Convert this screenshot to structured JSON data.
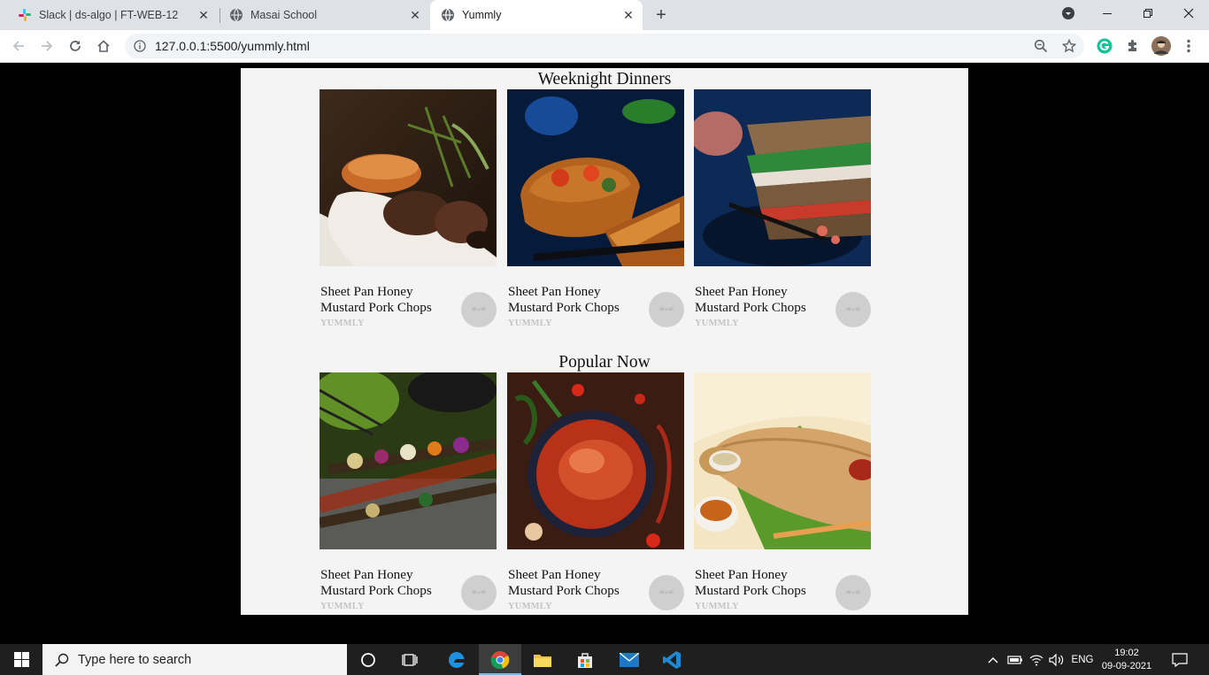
{
  "browser": {
    "tabs": [
      {
        "title": "Slack | ds-algo | FT-WEB-12",
        "icon": "slack-icon",
        "active": false
      },
      {
        "title": "Masai School",
        "icon": "globe-icon",
        "active": false
      },
      {
        "title": "Yummly",
        "icon": "globe-icon",
        "active": true
      }
    ],
    "url": "127.0.0.1:5500/yummly.html"
  },
  "page": {
    "sections": [
      {
        "title": "Weeknight Dinners",
        "cards": [
          {
            "caption": "Sheet Pan Honey Mustard Pork Chops",
            "source": "YUMMLY",
            "avatar_text": "60 x 60",
            "image": "lamb-salmon-plate"
          },
          {
            "caption": "Sheet Pan Honey Mustard Pork Chops",
            "source": "YUMMLY",
            "avatar_text": "60 x 60",
            "image": "vegetable-quiche"
          },
          {
            "caption": "Sheet Pan Honey Mustard Pork Chops",
            "source": "YUMMLY",
            "avatar_text": "60 x 60",
            "image": "club-sandwich"
          }
        ]
      },
      {
        "title": "Popular Now",
        "cards": [
          {
            "caption": "Sheet Pan Honey Mustard Pork Chops",
            "source": "YUMMLY",
            "avatar_text": "60 x 60",
            "image": "grill-skewers"
          },
          {
            "caption": "Sheet Pan Honey Mustard Pork Chops",
            "source": "YUMMLY",
            "avatar_text": "60 x 60",
            "image": "fish-curry"
          },
          {
            "caption": "Sheet Pan Honey Mustard Pork Chops",
            "source": "YUMMLY",
            "avatar_text": "60 x 60",
            "image": "dosa"
          }
        ]
      }
    ]
  },
  "taskbar": {
    "search_placeholder": "Type here to search",
    "language": "ENG",
    "time": "19:02",
    "date": "09-09-2021"
  },
  "colors": {
    "page_bg": "#f4f4f4",
    "outer_bg": "#000000",
    "source_text": "#c4c4c4",
    "avatar_bg": "#cfcfcf"
  }
}
